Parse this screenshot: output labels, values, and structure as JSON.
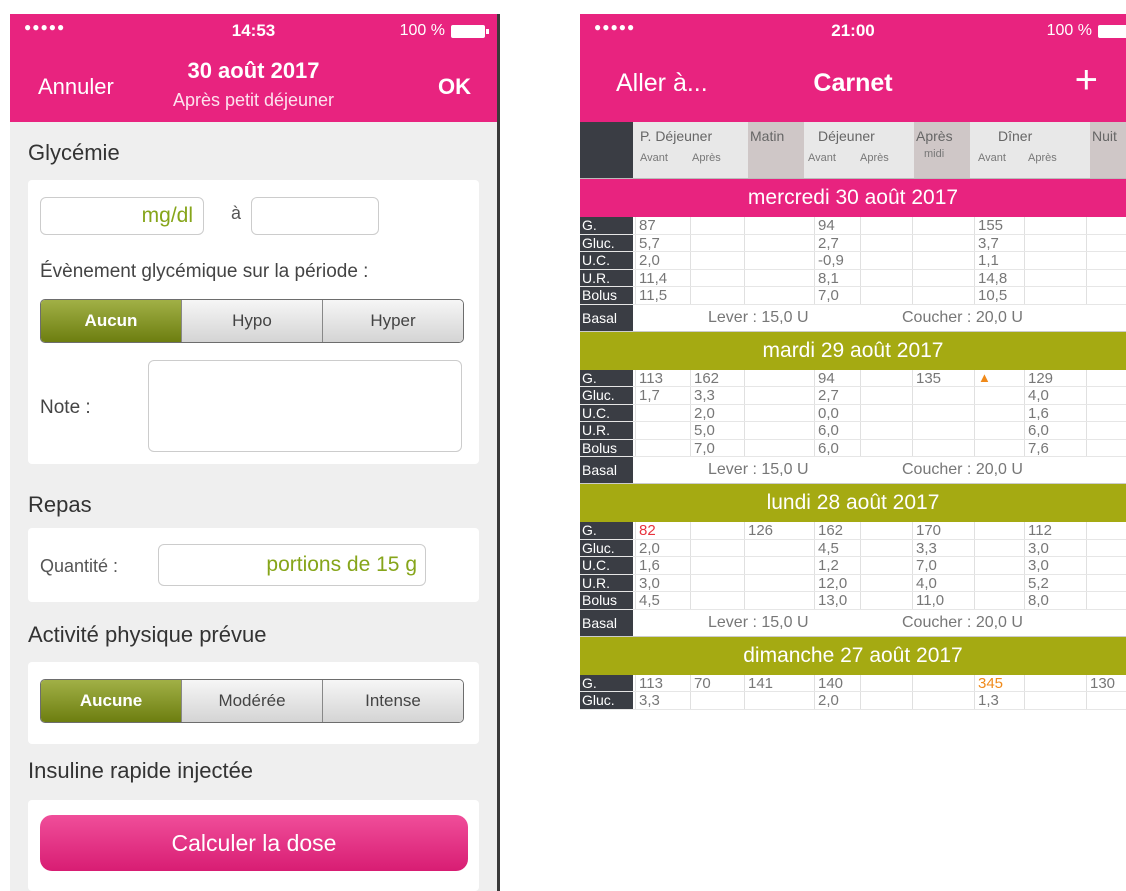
{
  "left": {
    "status": {
      "time": "14:53",
      "battery": "100 %"
    },
    "nav": {
      "cancel": "Annuler",
      "title": "30 août 2017",
      "subtitle": "Après petit déjeuner",
      "ok": "OK"
    },
    "glycemie": {
      "heading": "Glycémie",
      "unit": "mg/dl",
      "at": "à",
      "event_label": "Évènement glycémique sur la période :",
      "event_options": [
        "Aucun",
        "Hypo",
        "Hyper"
      ],
      "event_selected": "Aucun",
      "note_label": "Note :"
    },
    "repas": {
      "heading": "Repas",
      "quantity_label": "Quantité :",
      "quantity_placeholder": "portions de 15 g"
    },
    "activite": {
      "heading": "Activité physique prévue",
      "options": [
        "Aucune",
        "Modérée",
        "Intense"
      ],
      "selected": "Aucune"
    },
    "insuline": {
      "heading": "Insuline rapide injectée",
      "button": "Calculer la dose"
    }
  },
  "right": {
    "status": {
      "time": "21:00",
      "battery": "100 %"
    },
    "nav": {
      "goto": "Aller à...",
      "title": "Carnet"
    },
    "columns": {
      "pdej": "P. Déjeuner",
      "matin": "Matin",
      "dej": "Déjeuner",
      "apres_midi_1": "Après",
      "apres_midi_2": "midi",
      "diner": "Dîner",
      "nuit": "Nuit",
      "avant": "Avant",
      "apres": "Après"
    },
    "row_labels": [
      "G.",
      "Gluc.",
      "U.C.",
      "U.R.",
      "Bolus"
    ],
    "basal_label": "Basal",
    "days": [
      {
        "title": "mercredi 30 août 2017",
        "color": "#e8237f",
        "rows": [
          [
            "87",
            "",
            "",
            "94",
            "",
            "",
            "155",
            "",
            ""
          ],
          [
            "5,7",
            "",
            "",
            "2,7",
            "",
            "",
            "3,7",
            "",
            ""
          ],
          [
            "2,0",
            "",
            "",
            "-0,9",
            "",
            "",
            "1,1",
            "",
            ""
          ],
          [
            "11,4",
            "",
            "",
            "8,1",
            "",
            "",
            "14,8",
            "",
            ""
          ],
          [
            "11,5",
            "",
            "",
            "7,0",
            "",
            "",
            "10,5",
            "",
            ""
          ]
        ],
        "basal_lever": "Lever : 15,0 U",
        "basal_coucher": "Coucher : 20,0 U"
      },
      {
        "title": "mardi 29 août 2017",
        "color": "#a5aa12",
        "rows": [
          [
            "113",
            "162",
            "",
            "94",
            "",
            "135",
            "▲",
            "129",
            ""
          ],
          [
            "1,7",
            "3,3",
            "",
            "2,7",
            "",
            "",
            "",
            "4,0",
            ""
          ],
          [
            "",
            "2,0",
            "",
            "0,0",
            "",
            "",
            "",
            "1,6",
            ""
          ],
          [
            "",
            "5,0",
            "",
            "6,0",
            "",
            "",
            "",
            "6,0",
            ""
          ],
          [
            "",
            "7,0",
            "",
            "6,0",
            "",
            "",
            "",
            "7,6",
            ""
          ]
        ],
        "basal_lever": "Lever : 15,0 U",
        "basal_coucher": "Coucher : 20,0 U"
      },
      {
        "title": "lundi 28 août 2017",
        "color": "#a5aa12",
        "rows": [
          [
            "82",
            "",
            "126",
            "162",
            "",
            "170",
            "",
            "112",
            ""
          ],
          [
            "2,0",
            "",
            "",
            "4,5",
            "",
            "3,3",
            "",
            "3,0",
            ""
          ],
          [
            "1,6",
            "",
            "",
            "1,2",
            "",
            "7,0",
            "",
            "3,0",
            ""
          ],
          [
            "3,0",
            "",
            "",
            "12,0",
            "",
            "4,0",
            "",
            "5,2",
            ""
          ],
          [
            "4,5",
            "",
            "",
            "13,0",
            "",
            "11,0",
            "",
            "8,0",
            ""
          ]
        ],
        "basal_lever": "Lever : 15,0 U",
        "basal_coucher": "Coucher : 20,0 U"
      },
      {
        "title": "dimanche 27 août 2017",
        "color": "#a5aa12",
        "rows": [
          [
            "113",
            "70",
            "141",
            "140",
            "",
            "",
            "345",
            "",
            "130"
          ],
          [
            "3,3",
            "",
            "",
            "2,0",
            "",
            "",
            "1,3",
            "",
            ""
          ]
        ]
      }
    ]
  }
}
